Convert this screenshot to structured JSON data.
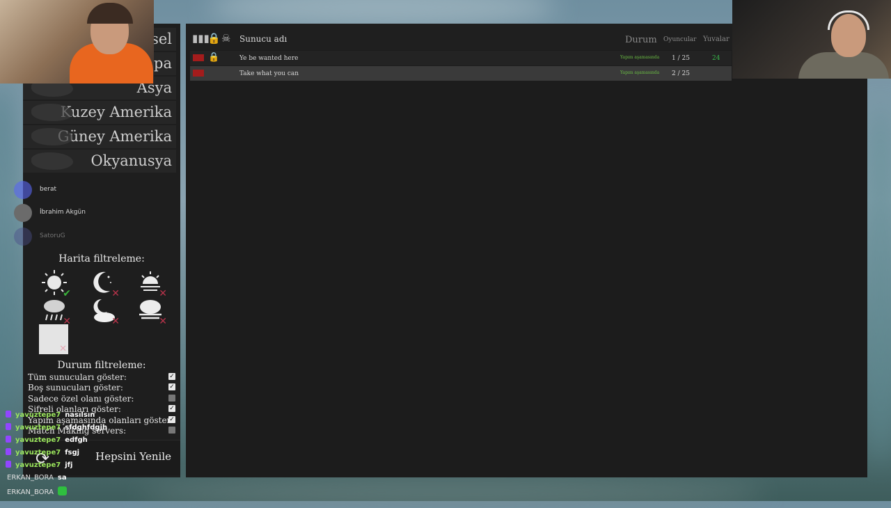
{
  "regions": [
    "Genesel",
    "Avrupa",
    "Asya",
    "Kuzey Amerika",
    "Güney Amerika",
    "Okyanusya"
  ],
  "map_filter": {
    "title": "Harita filtreleme:",
    "icons": [
      {
        "name": "sun-icon",
        "state": "on"
      },
      {
        "name": "moon-icon",
        "state": "off"
      },
      {
        "name": "sunset-icon",
        "state": "off"
      },
      {
        "name": "rain-icon",
        "state": "off"
      },
      {
        "name": "night-cloud-icon",
        "state": "off"
      },
      {
        "name": "fog-icon",
        "state": "off"
      }
    ]
  },
  "status_filter": {
    "title": "Durum filtreleme:",
    "options": [
      {
        "label": "Tüm sunucuları göster:",
        "checked": true
      },
      {
        "label": "Boş sunucuları göster:",
        "checked": true
      },
      {
        "label": "Sadece özel olanı göster:",
        "checked": false
      },
      {
        "label": "Şifreli olanları göster:",
        "checked": true
      },
      {
        "label": "Yapım aşamasında olanları göster:",
        "checked": true
      },
      {
        "label": "Match Making servers:",
        "checked": false
      }
    ]
  },
  "refresh": {
    "label": "Hepsini Yenile"
  },
  "server_list": {
    "header": {
      "name": "Sunucu adı",
      "status": "Durum",
      "players": "Oyuncular",
      "slots": "Yuvalar"
    },
    "rows": [
      {
        "name": "Ye be wanted here",
        "locked": true,
        "state": "Yapım aşamasında",
        "players": "1 / 25",
        "slots": "24"
      },
      {
        "name": "Take what you can",
        "locked": false,
        "state": "Yapım aşamasında",
        "players": "2 / 25",
        "slots": ""
      }
    ]
  },
  "discord": [
    {
      "name": "berat"
    },
    {
      "name": "İbrahim Akgün"
    },
    {
      "name": "SatoruG"
    }
  ],
  "chat": [
    {
      "user": "yavuztepe7",
      "msg": "nasılsın"
    },
    {
      "user": "yavuztepe7",
      "msg": "sfdghfdgjh"
    },
    {
      "user": "yavuztepe7",
      "msg": "edfgh"
    },
    {
      "user": "yavuztepe7",
      "msg": "fsgj"
    },
    {
      "user": "yavuztepe7",
      "msg": "jfj"
    },
    {
      "user": "ERKAN_BORA",
      "msg": "sa"
    },
    {
      "user": "ERKAN_BORA",
      "msg": ""
    }
  ],
  "colors": {
    "ping": "#a31c1c",
    "state": "#6bbf44",
    "slots": "#39b54a",
    "chat_user": "#9be65c"
  }
}
